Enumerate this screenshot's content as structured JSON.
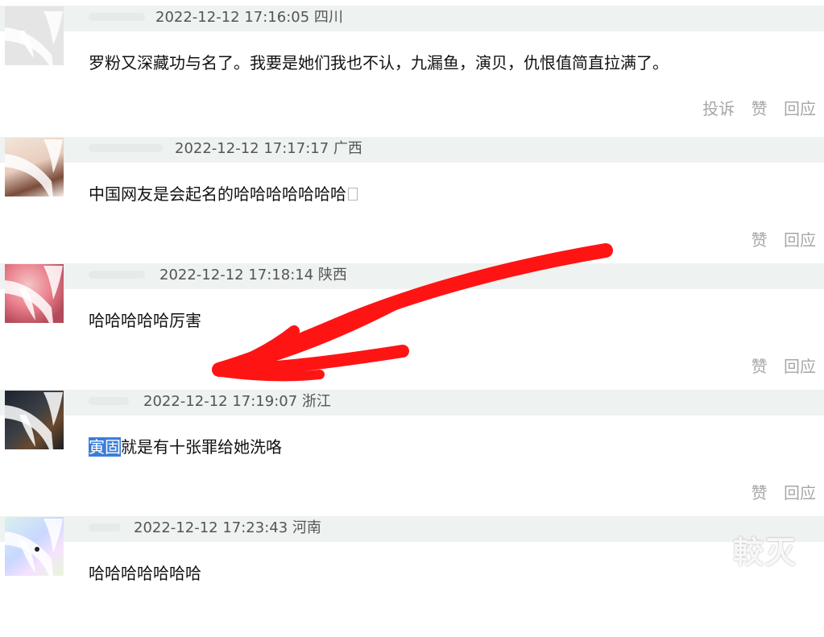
{
  "comments": [
    {
      "timestamp": "2022-12-12 17:16:05",
      "location": "四川",
      "content": "罗粉又深藏功与名了。我要是她们我也不认，九漏鱼，演贝，仇恨值简直拉满了。",
      "actions": {
        "report": "投诉",
        "like": "赞",
        "reply": "回应"
      }
    },
    {
      "timestamp": "2022-12-12 17:17:17",
      "location": "广西",
      "content": "中国网友是会起名的哈哈哈哈哈哈哈",
      "actions": {
        "like": "赞",
        "reply": "回应"
      }
    },
    {
      "timestamp": "2022-12-12 17:18:14",
      "location": "陕西",
      "content": "哈哈哈哈哈厉害",
      "actions": {
        "like": "赞",
        "reply": "回应"
      }
    },
    {
      "timestamp": "2022-12-12 17:19:07",
      "location": "浙江",
      "content_highlight": "寅固",
      "content_rest": "就是有十张罪给她洗咯",
      "actions": {
        "like": "赞",
        "reply": "回应"
      }
    },
    {
      "timestamp": "2022-12-12 17:23:43",
      "location": "河南",
      "content": "哈哈哈哈哈哈哈"
    }
  ],
  "watermark": "較灭",
  "colors": {
    "header_bar": "#eef2f0",
    "action_text": "#a7a7a7",
    "selection": "#3b7dd8",
    "annotation_arrow": "#ff1414"
  },
  "icons": {
    "avatar_overlay": "check-shaped-mask",
    "annotation": "red-hand-drawn-arrow"
  }
}
